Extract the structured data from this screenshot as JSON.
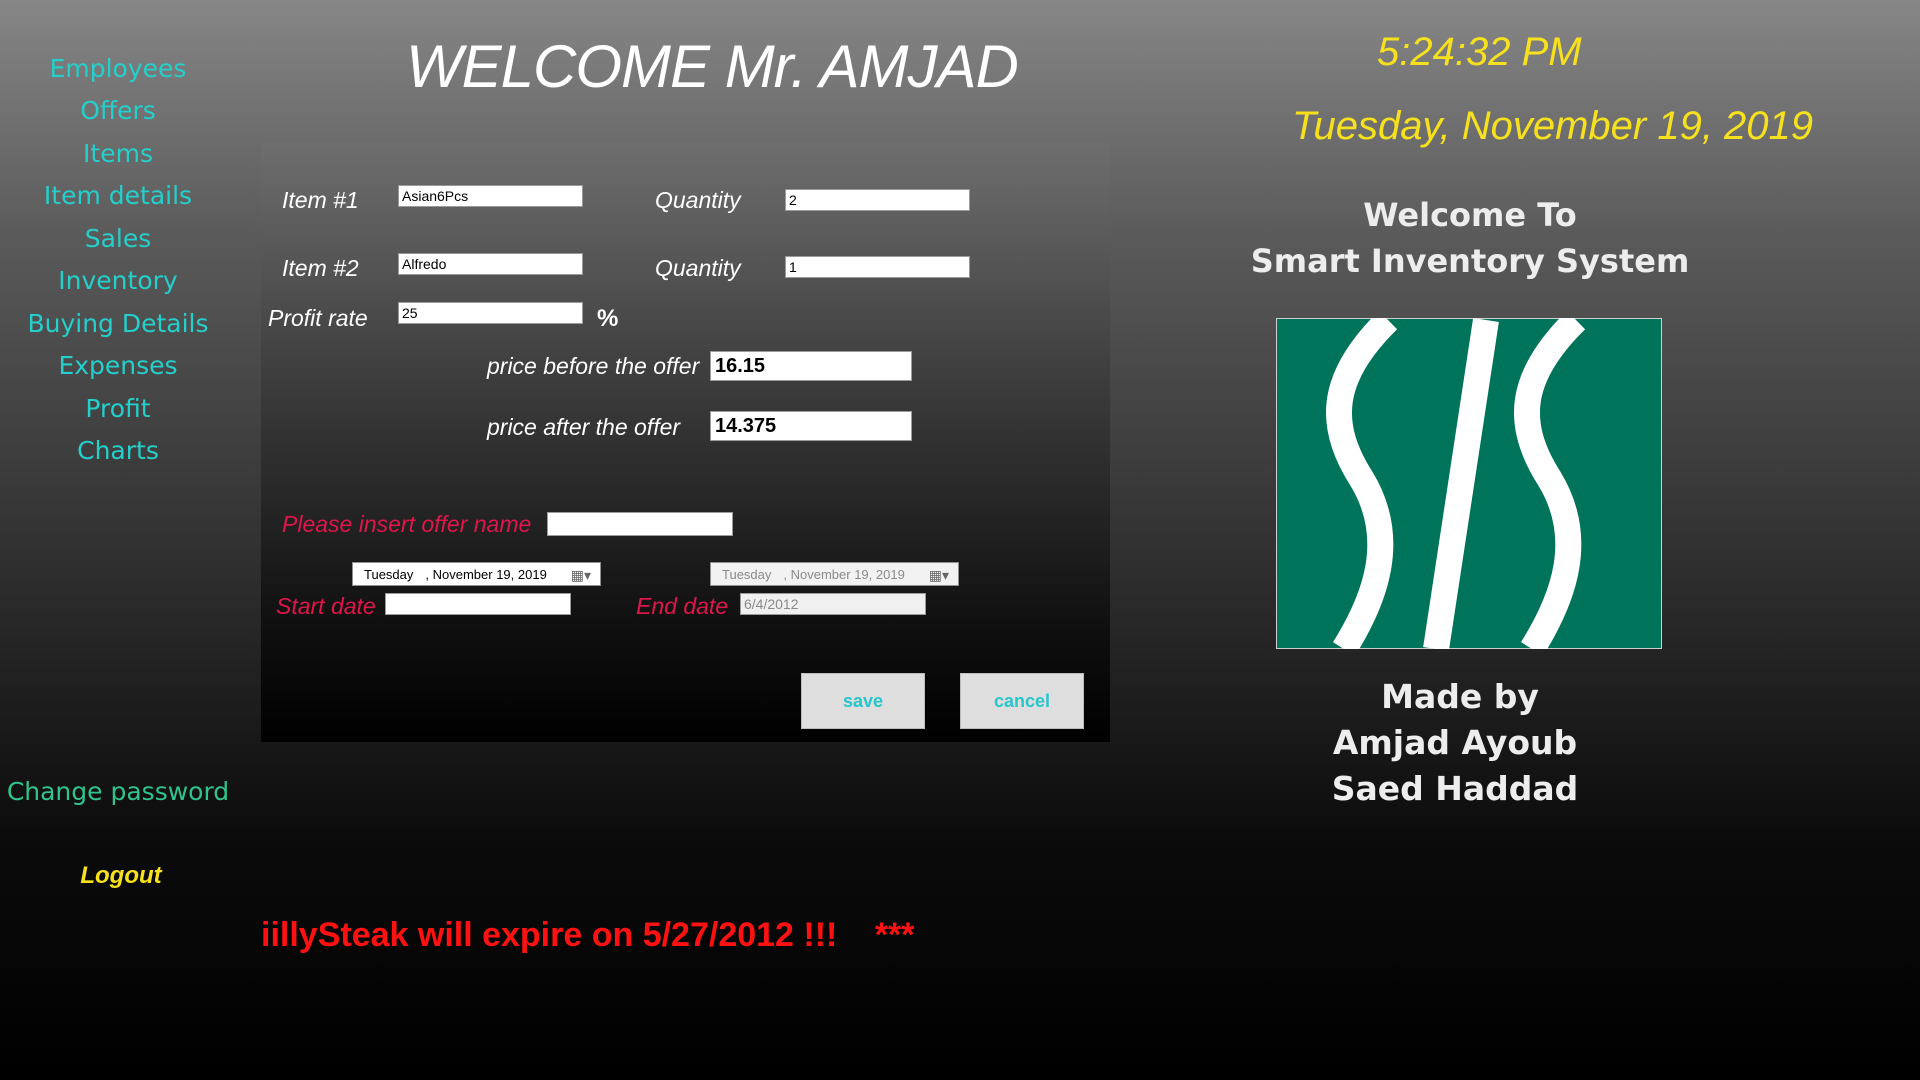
{
  "nav": {
    "items": [
      "Employees",
      "Offers",
      "Items",
      "Item details",
      "Sales",
      "Inventory",
      "Buying Details",
      "Expenses",
      "Profit",
      "Charts"
    ],
    "change_password": "Change password",
    "logout": "Logout"
  },
  "header": {
    "welcome": "WELCOME Mr. AMJAD",
    "time": "5:24:32 PM",
    "date": "Tuesday, November 19, 2019"
  },
  "form": {
    "item1_label": "Item #1",
    "item1_value": "Asian6Pcs",
    "item2_label": "Item #2",
    "item2_value": "Alfredo",
    "quantity_label": "Quantity",
    "quantity1_value": "2",
    "quantity2_value": "1",
    "profit_rate_label": "Profit rate",
    "profit_rate_value": "25",
    "percent_sign": "%",
    "price_before_label": "price before the offer",
    "price_before_value": "16.15",
    "price_after_label": "price after the offer",
    "price_after_value": "14.375",
    "offer_name_label": "Please insert offer name",
    "offer_name_value": "",
    "start_picker_day": "Tuesday",
    "start_picker_date": ", November 19, 2019",
    "end_picker_day": "Tuesday",
    "end_picker_date": ", November 19, 2019",
    "start_date_label": "Start date",
    "start_date_value": "",
    "end_date_label": "End date",
    "end_date_value": "6/4/2012",
    "save_label": "save",
    "cancel_label": "cancel"
  },
  "side": {
    "welcome_line1": "Welcome To",
    "welcome_line2": "Smart Inventory System",
    "made_by": "Made by",
    "author1": "Amjad Ayoub",
    "author2": "Saed Haddad"
  },
  "ticker": {
    "message": "iillySteak will expire on 5/27/2012 !!!",
    "stars": "***"
  },
  "colors": {
    "nav": "#24d0cc",
    "clock": "#f7e11e",
    "alert_red": "#e0154a",
    "ticker_red": "#ff0000",
    "logo_green": "#00745a",
    "button_text": "#26c6cc"
  },
  "icons": {
    "calendar": "calendar-dropdown-icon",
    "logo": "sis-logo"
  }
}
